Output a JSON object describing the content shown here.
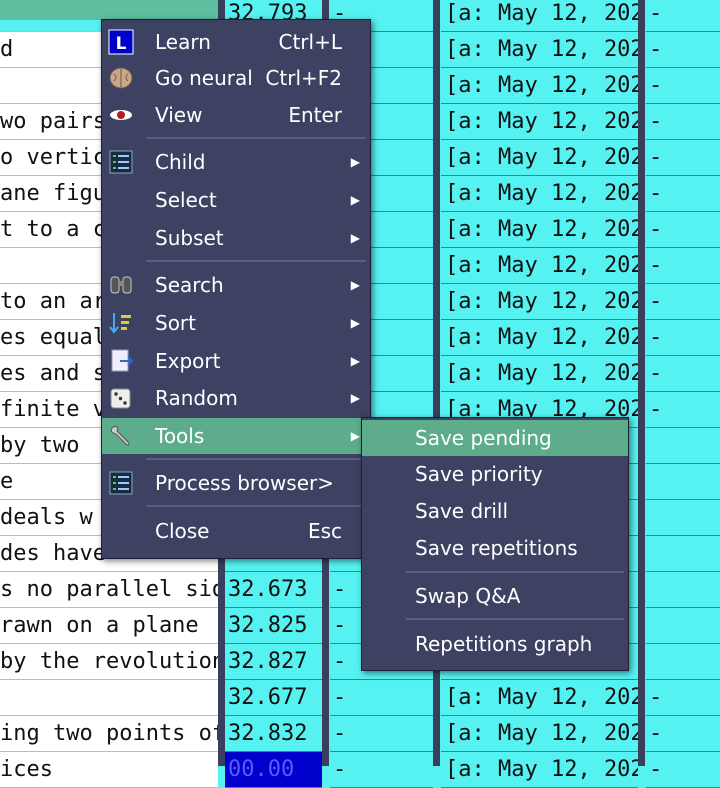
{
  "grid": {
    "rows": [
      {
        "text": "",
        "num": "32.793",
        "dash": "-",
        "date": "[a: May 12, 202",
        "end": "-"
      },
      {
        "text": "d",
        "num": "",
        "dash": "",
        "date": "[a: May 12, 202",
        "end": "-"
      },
      {
        "text": "",
        "num": "",
        "dash": "",
        "date": "[a: May 12, 202",
        "end": "-"
      },
      {
        "text": "wo pairs",
        "num": "",
        "dash": "",
        "date": "[a: May 12, 202",
        "end": "-"
      },
      {
        "text": "o vertic",
        "num": "",
        "dash": "",
        "date": "[a: May 12, 202",
        "end": "-"
      },
      {
        "text": "ane figu",
        "num": "",
        "dash": "",
        "date": "[a: May 12, 202",
        "end": "-"
      },
      {
        "text": "t to a c",
        "num": "",
        "dash": "",
        "date": "[a: May 12, 202",
        "end": "-"
      },
      {
        "text": "",
        "num": "",
        "dash": "",
        "date": "[a: May 12, 202",
        "end": "-"
      },
      {
        "text": "to an ar",
        "num": "",
        "dash": "",
        "date": "[a: May 12, 202",
        "end": "-"
      },
      {
        "text": "es equal",
        "num": "",
        "dash": "",
        "date": "[a: May 12, 202",
        "end": "-"
      },
      {
        "text": "es and s",
        "num": "",
        "dash": "",
        "date": "[a: May 12, 202",
        "end": "-"
      },
      {
        "text": "finite v",
        "num": "",
        "dash": "",
        "date": "[a: May 12, 202",
        "end": "-"
      },
      {
        "text": " by two ",
        "num": "",
        "dash": "",
        "date": "",
        "end": ""
      },
      {
        "text": "e",
        "num": "",
        "dash": "",
        "date": "",
        "end": ""
      },
      {
        "text": " deals w",
        "num": "",
        "dash": "",
        "date": "",
        "end": ""
      },
      {
        "text": "des have",
        "num": "",
        "dash": "",
        "date": "",
        "end": ""
      },
      {
        "text": "s no parallel sid",
        "num": "32.673",
        "dash": "-",
        "date": "",
        "end": ""
      },
      {
        "text": "rawn on a plane",
        "num": "32.825",
        "dash": "-",
        "date": "",
        "end": ""
      },
      {
        "text": "by the revolution",
        "num": "32.827",
        "dash": "-",
        "date": "",
        "end": ""
      },
      {
        "text": "",
        "num": "32.677",
        "dash": "-",
        "date": "[a: May 12, 202",
        "end": "-"
      },
      {
        "text": "ing two points of",
        "num": "32.832",
        "dash": "-",
        "date": "[a: May 12, 202",
        "end": "-"
      },
      {
        "text": "ices",
        "num": "00.00",
        "dash": "-",
        "date": "[a: May 12, 202",
        "end": "-"
      }
    ]
  },
  "context_menu": {
    "items": [
      {
        "label": "Learn",
        "shortcut": "Ctrl+L",
        "icon": "learn-icon"
      },
      {
        "label": "Go neural",
        "shortcut": "Ctrl+F2",
        "icon": "brain-icon"
      },
      {
        "label": "View",
        "shortcut": "Enter",
        "icon": "eye-icon"
      },
      {
        "label": "Child",
        "icon": "list-icon"
      },
      {
        "label": "Select"
      },
      {
        "label": "Subset"
      },
      {
        "label": "Search",
        "icon": "binoculars-icon"
      },
      {
        "label": "Sort",
        "icon": "sort-icon"
      },
      {
        "label": "Export",
        "icon": "export-icon"
      },
      {
        "label": "Random",
        "icon": "dice-icon"
      },
      {
        "label": "Tools",
        "icon": "wrench-icon"
      },
      {
        "label": "Process browser>",
        "icon": "list-icon"
      },
      {
        "label": "Close",
        "shortcut": "Esc"
      }
    ]
  },
  "tools_submenu": {
    "items": [
      {
        "label": "Save pending"
      },
      {
        "label": "Save priority"
      },
      {
        "label": "Save drill"
      },
      {
        "label": "Save repetitions"
      },
      {
        "label": "Swap Q&A"
      },
      {
        "label": "Repetitions graph"
      }
    ]
  },
  "colors": {
    "grid_bg": "#56f2f2",
    "menu_bg": "#3d4263",
    "highlight": "#5dac8c",
    "accent_blue": "#0000cc"
  }
}
